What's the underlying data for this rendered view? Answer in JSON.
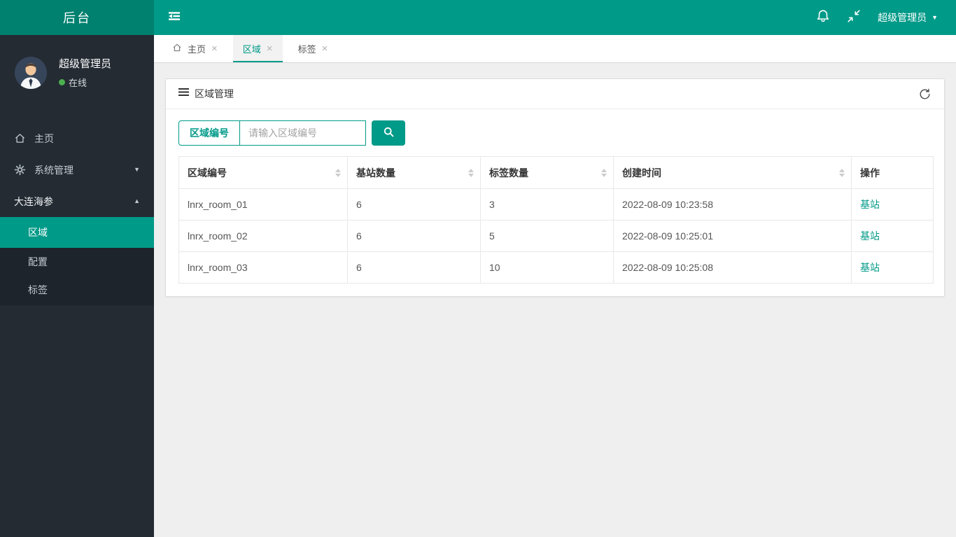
{
  "colors": {
    "accent": "#009a88",
    "header_bg": "#009a88",
    "brand_bg": "#00806f",
    "sidebar_bg": "#242b33",
    "submenu_bg": "#1d242b",
    "online_dot": "#4caf50",
    "content_bg": "#efefef"
  },
  "icons": {
    "close": "×",
    "caret_down": "▼",
    "caret_up": "▲"
  },
  "header": {
    "brand": "后台",
    "user_label": "超级管理员"
  },
  "sidebar": {
    "user": {
      "name": "超级管理员",
      "status_label": "在线"
    },
    "menu": [
      {
        "label": "主页"
      },
      {
        "label": "系统管理"
      },
      {
        "label": "大连海参"
      }
    ],
    "submenu": [
      {
        "label": "区域",
        "active": true
      },
      {
        "label": "配置",
        "active": false
      },
      {
        "label": "标签",
        "active": false
      }
    ]
  },
  "tabs": [
    {
      "label": "主页",
      "active": false
    },
    {
      "label": "区域",
      "active": true
    },
    {
      "label": "标签",
      "active": false
    }
  ],
  "panel": {
    "title": "区域管理",
    "search": {
      "field_label": "区域编号",
      "placeholder": "请输入区域编号",
      "value": ""
    }
  },
  "table": {
    "columns": [
      {
        "label": "区域编号",
        "sortable": true
      },
      {
        "label": "基站数量",
        "sortable": true
      },
      {
        "label": "标签数量",
        "sortable": true
      },
      {
        "label": "创建时间",
        "sortable": true
      },
      {
        "label": "操作",
        "sortable": false
      }
    ],
    "rows": [
      {
        "region_id": "lnrx_room_01",
        "base_stations": "6",
        "tag_count": "3",
        "created_at": "2022-08-09 10:23:58",
        "action": "基站"
      },
      {
        "region_id": "lnrx_room_02",
        "base_stations": "6",
        "tag_count": "5",
        "created_at": "2022-08-09 10:25:01",
        "action": "基站"
      },
      {
        "region_id": "lnrx_room_03",
        "base_stations": "6",
        "tag_count": "10",
        "created_at": "2022-08-09 10:25:08",
        "action": "基站"
      }
    ]
  }
}
